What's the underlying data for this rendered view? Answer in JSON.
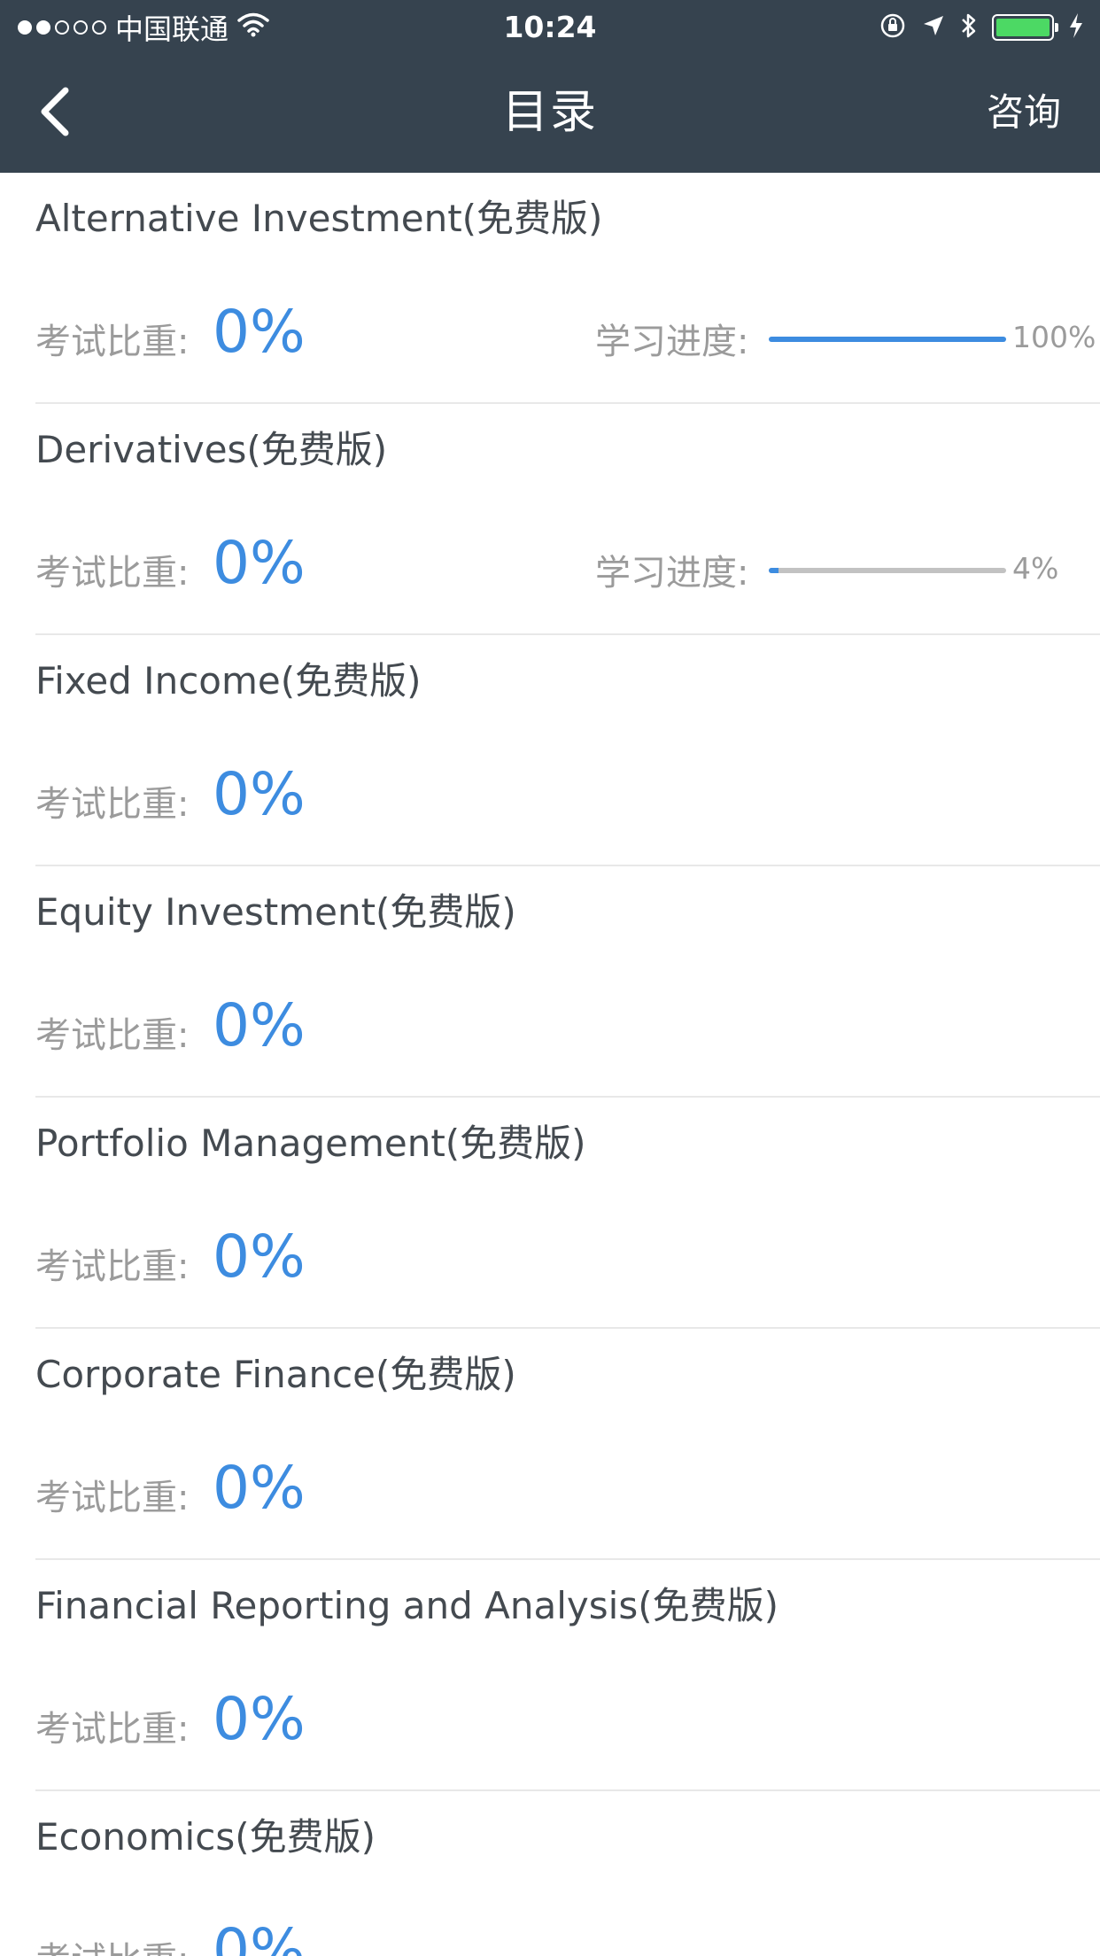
{
  "status_bar": {
    "carrier": "中国联通",
    "time": "10:24",
    "signal_bars_filled": 2,
    "signal_bars_total": 5,
    "battery_level": 1.0,
    "icons": [
      "wifi-icon",
      "orientation-lock-icon",
      "location-icon",
      "bluetooth-icon",
      "battery-icon",
      "charging-icon"
    ]
  },
  "nav": {
    "title": "目录",
    "action_label": "咨询",
    "back_icon": "chevron-left-icon"
  },
  "colors": {
    "nav_background": "#36434f",
    "accent": "#3d8ce0",
    "label_gray": "#9b9b9b",
    "title_text": "#444a50",
    "track_gray": "#c2c2c2"
  },
  "items": [
    {
      "title": "Alternative Investment(免费版)",
      "weight_label": "考试比重:",
      "weight_value": "0%",
      "progress_label": "学习进度:",
      "progress_text": "100%",
      "progress": 1.0
    },
    {
      "title": "Derivatives(免费版)",
      "weight_label": "考试比重:",
      "weight_value": "0%",
      "progress_label": "学习进度:",
      "progress_text": "4%",
      "progress": 0.04
    },
    {
      "title": "Fixed Income(免费版)",
      "weight_label": "考试比重:",
      "weight_value": "0%"
    },
    {
      "title": "Equity Investment(免费版)",
      "weight_label": "考试比重:",
      "weight_value": "0%"
    },
    {
      "title": "Portfolio Management(免费版)",
      "weight_label": "考试比重:",
      "weight_value": "0%"
    },
    {
      "title": "Corporate Finance(免费版)",
      "weight_label": "考试比重:",
      "weight_value": "0%"
    },
    {
      "title": "Financial Reporting and Analysis(免费版)",
      "weight_label": "考试比重:",
      "weight_value": "0%"
    },
    {
      "title": "Economics(免费版)",
      "weight_label": "考试比重:",
      "weight_value": "0%"
    }
  ]
}
